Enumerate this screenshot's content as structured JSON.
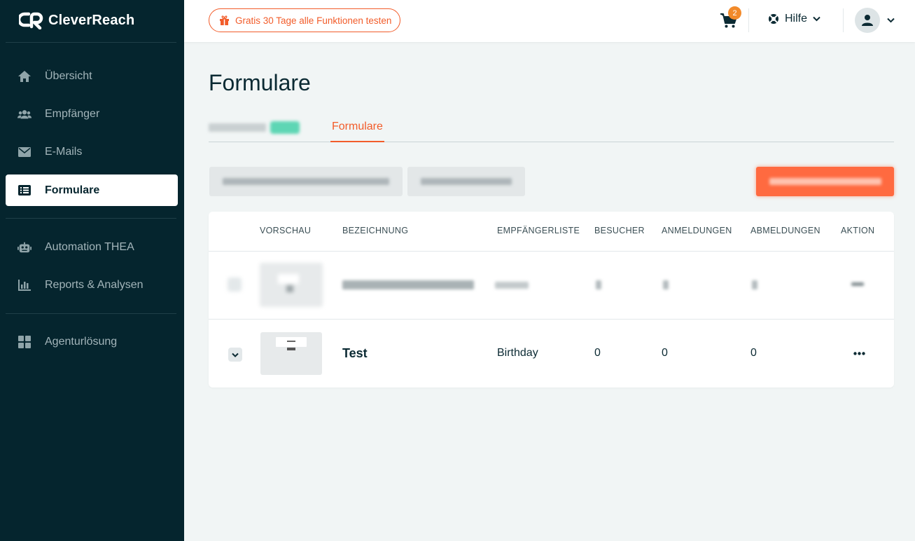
{
  "brand": {
    "name": "CleverReach",
    "accent": "#f25c2a",
    "sidebar_bg": "#05252e"
  },
  "sidebar": {
    "items": [
      {
        "label": "Übersicht",
        "icon": "home-icon"
      },
      {
        "label": "Empfänger",
        "icon": "users-icon"
      },
      {
        "label": "E-Mails",
        "icon": "envelope-icon"
      },
      {
        "label": "Formulare",
        "icon": "list-icon",
        "active": true
      },
      {
        "label": "Automation THEA",
        "icon": "robot-icon"
      },
      {
        "label": "Reports & Analysen",
        "icon": "chart-icon"
      },
      {
        "label": "Agenturlösung",
        "icon": "grid-icon"
      }
    ]
  },
  "topbar": {
    "promo": "Gratis 30 Tage alle Funktionen testen",
    "cart_count": "2",
    "help": "Hilfe"
  },
  "page": {
    "title": "Formulare",
    "tabs": {
      "active": "Formulare"
    }
  },
  "table": {
    "headers": {
      "preview": "VORSCHAU",
      "name": "BEZEICHNUNG",
      "list": "EMPFÄNGERLISTE",
      "visitors": "BESUCHER",
      "signups": "ANMELDUNGEN",
      "unsubscribes": "ABMELDUNGEN",
      "action": "AKTION"
    },
    "rows": [
      {
        "name": "Test",
        "list": "Birthday",
        "visitors": "0",
        "signups": "0",
        "unsubscribes": "0"
      }
    ]
  }
}
